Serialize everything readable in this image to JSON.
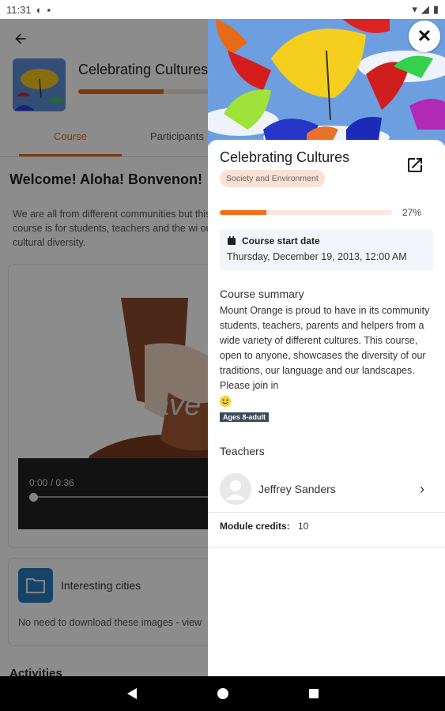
{
  "status": {
    "time": "11:31"
  },
  "course": {
    "title": "Celebrating Cultures",
    "tabs": [
      "Course",
      "Participants"
    ],
    "welcome": "Welcome! Aloha! Bonvenon!",
    "intro": "We are all from different communities but this course is for students, teachers and the wi our cultural diversity.",
    "video": {
      "time": "0:00 / 0:36",
      "overlay": "ave "
    },
    "folder": {
      "name": "Interesting cities",
      "desc": "No need to download these images - view"
    },
    "activities": "Activities"
  },
  "summary": {
    "title": "Celebrating Cultures",
    "category": "Society and Environment",
    "progress": 27,
    "progress_label": "27%",
    "start_label": "Course start date",
    "start_value": "Thursday, December 19, 2013, 12:00 AM",
    "summary_heading": "Course summary",
    "summary_text": "Mount Orange is proud to have in its community students, teachers, parents and helpers from a wide variety of different cultures. This course, open to anyone, showcases the diversity of our traditions, our language and our landscapes. Please join in",
    "ages_badge": "Ages 8-adult",
    "teachers_heading": "Teachers",
    "teacher_name": "Jeffrey Sanders",
    "credits_label": "Module credits:",
    "credits_value": "10"
  },
  "colors": {
    "accent": "#f36e1b",
    "folder": "#2a7bbf"
  },
  "icons": [
    "back-arrow-icon",
    "close-icon",
    "open-external-icon",
    "calendar-icon",
    "chevron-right-icon",
    "folder-icon",
    "nav-back-icon",
    "nav-home-icon",
    "nav-recents-icon"
  ]
}
